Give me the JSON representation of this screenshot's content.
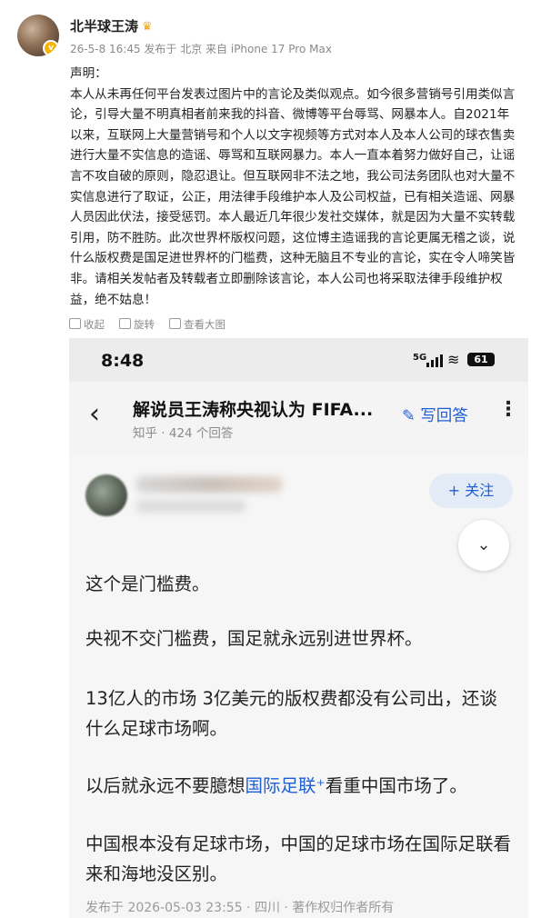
{
  "post": {
    "username": "北半球王涛",
    "crown_icon": "crown-icon",
    "meta": "26-5-8 16:45 发布于 北京 来自 iPhone 17 Pro Max",
    "content_lines": [
      "声明：",
      "本人从未再任何平台发表过图片中的言论及类似观点。如今很多营销号引用类似言",
      "论，引导大量不明真相者前来我的抖音、微博等平台辱骂、网暴本人。自2021年",
      "以来，互联网上大量营销号和个人以文字视频等方式对本人及本人公司的球衣售卖",
      "进行大量不实信息的造谣、辱骂和互联网暴力。本人一直本着努力做好自己，让谣",
      "言不攻自破的原则，隐忍退让。但互联网非不法之地，我公司法务团队也对大量不",
      "实信息进行了取证，公正，用法律手段维护本人及公司权益，已有相关造谣、网暴",
      "人员因此伏法，接受惩罚。本人最近几年很少发社交媒体，就是因为大量不实转载",
      "引用，防不胜防。此次世界杯版权问题，这位博主造谣我的言论更属无稽之谈，说",
      "什么版权费是国足进世界杯的门槛费，这种无脑且不专业的言论，实在令人啼笑皆",
      "非。请相关发帖者及转载者立即删除该言论，本人公司也将采取法律手段维护权",
      "益，绝不姑息！"
    ],
    "actions": {
      "collect": "收起",
      "rotate": "旋转",
      "view_full": "查看大图"
    }
  },
  "screenshot": {
    "status": {
      "time": "8:48",
      "network": "5G",
      "battery": "61"
    },
    "nav": {
      "back_icon": "chevron-left-icon",
      "title": "解说员王涛称央视认为 FIFA...",
      "subtitle": "知乎 · 424 个回答",
      "write_answer": "写回答",
      "more_icon": "more-vertical-icon"
    },
    "follow_button": "+ 关注",
    "collapse_icon": "double-chevron-down-icon",
    "paragraphs": [
      "这个是门槛费。",
      "央视不交门槛费，国足就永远别进世界杯。",
      "13亿人的市场 3亿美元的版权费都没有公司出，还谈什么足球市场啊。",
      "中国根本没有足球市场，中国的足球市场在国际足联看来和海地没区别。"
    ],
    "link_para": {
      "before": "以后就永远不要臆想",
      "link": "国际足联",
      "after": "看重中国市场了。"
    },
    "footer": "发布于 2026-05-03 23:55 · 四川 · 著作权归作者所有"
  }
}
